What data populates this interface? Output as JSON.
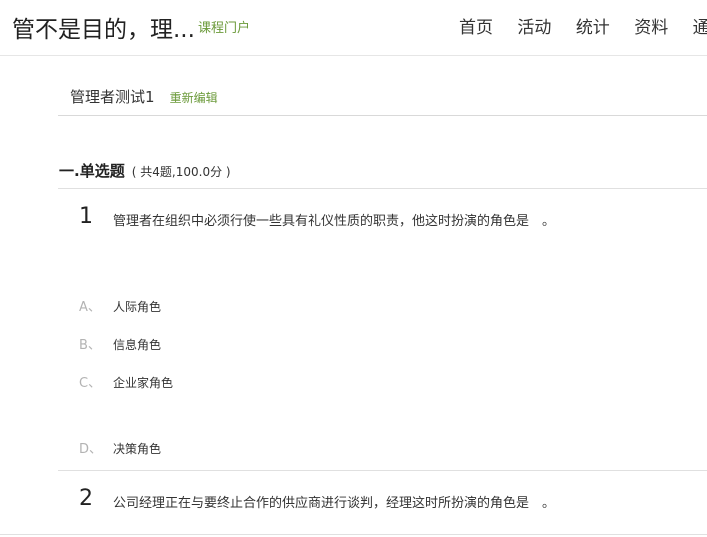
{
  "header": {
    "course_title": "管不是目的，理...",
    "portal_link": "课程门户",
    "nav": [
      "首页",
      "活动",
      "统计",
      "资料",
      "通"
    ]
  },
  "test": {
    "name": "管理者测试1",
    "edit_label": "重新编辑"
  },
  "section": {
    "title": "一.单选题",
    "meta": "( 共4题,100.0分 )"
  },
  "questions": [
    {
      "number": "1",
      "text": "管理者在组织中必须行使一些具有礼仪性质的职责，他这时扮演的角色是　。",
      "options": [
        {
          "letter": "A、",
          "text": "人际角色"
        },
        {
          "letter": "B、",
          "text": "信息角色"
        },
        {
          "letter": "C、",
          "text": "企业家角色"
        },
        {
          "letter": "D、",
          "text": "决策角色"
        }
      ]
    },
    {
      "number": "2",
      "text": "公司经理正在与要终止合作的供应商进行谈判，经理这时所扮演的角色是　。"
    }
  ]
}
